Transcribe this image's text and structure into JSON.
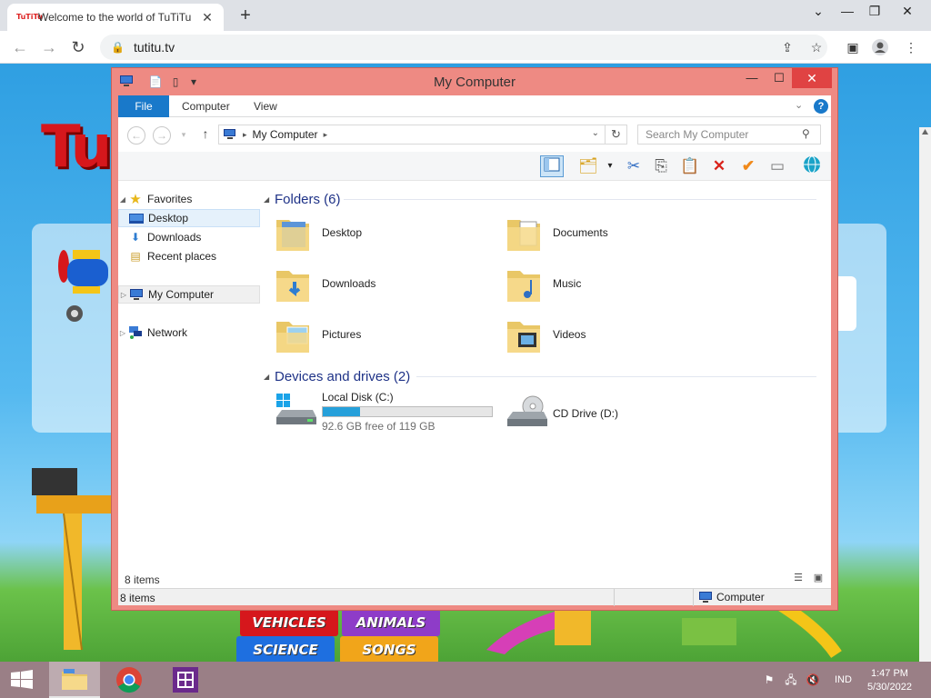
{
  "browser": {
    "tab_title": "Welcome to the world of TuTiTu",
    "tab_close": "✕",
    "new_tab": "+",
    "url": "tutitu.tv",
    "favicon_text": "TuTiTu"
  },
  "site": {
    "logo_text": "Tu",
    "blocks": [
      "VEHICLES",
      "ANIMALS",
      "SCIENCE",
      "SONGS"
    ]
  },
  "explorer": {
    "title": "My Computer",
    "ribbon": {
      "file": "File",
      "computer": "Computer",
      "view": "View"
    },
    "address": {
      "location": "My Computer"
    },
    "search": {
      "placeholder": "Search My Computer"
    },
    "nav": {
      "favorites": "Favorites",
      "desktop": "Desktop",
      "downloads": "Downloads",
      "recent": "Recent places",
      "my_computer": "My Computer",
      "network": "Network"
    },
    "folders_header": "Folders (6)",
    "folders": [
      "Desktop",
      "Documents",
      "Downloads",
      "Music",
      "Pictures",
      "Videos"
    ],
    "devices_header": "Devices and drives (2)",
    "drives": {
      "c_name": "Local Disk (C:)",
      "c_free": "92.6 GB free of 119 GB",
      "c_used_fraction": 0.22,
      "d_name": "CD Drive (D:)"
    },
    "status_items": "8 items",
    "details_items": "8 items",
    "details_zone": "Computer"
  },
  "taskbar": {
    "lang": "IND",
    "time": "1:47 PM",
    "date": "5/30/2022"
  },
  "colors": {
    "window_frame": "#ee8a83",
    "accent_blue": "#1979ca",
    "taskbar": "#9a7f86",
    "drive_fill": "#26a0da"
  }
}
